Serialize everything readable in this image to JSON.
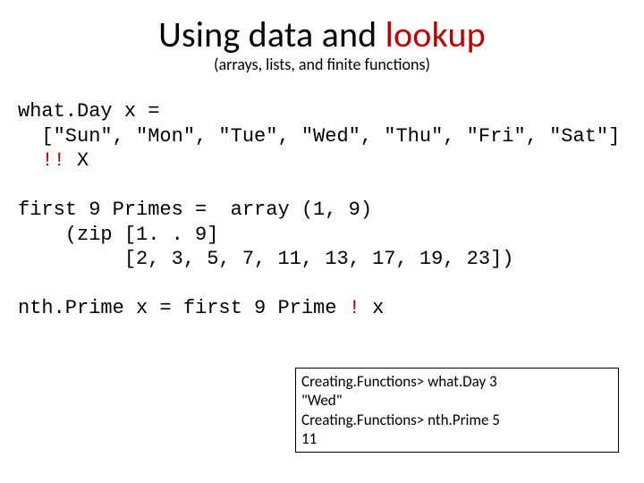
{
  "title_part1": "Using data and ",
  "title_part2": "lookup",
  "subtitle": "(arrays, lists, and finite functions)",
  "code_line1": "what.Day x =",
  "code_line2": "  [\"Sun\", \"Mon\", \"Tue\", \"Wed\", \"Thu\", \"Fri\", \"Sat\"]",
  "code_line3a": "  ",
  "code_line3_op": "!!",
  "code_line3b": " X",
  "code_line4": "",
  "code_line5": "first 9 Primes =  array (1, 9)",
  "code_line6": "    (zip [1. . 9]",
  "code_line7": "         [2, 3, 5, 7, 11, 13, 17, 19, 23])",
  "code_line8": "",
  "code_line9a": "nth.Prime x = first 9 Prime ",
  "code_line9_op": "!",
  "code_line9b": " x",
  "repl_line1": "Creating.Functions> what.Day 3",
  "repl_line2": "\"Wed\"",
  "repl_line3": "Creating.Functions> nth.Prime 5",
  "repl_line4": "11"
}
